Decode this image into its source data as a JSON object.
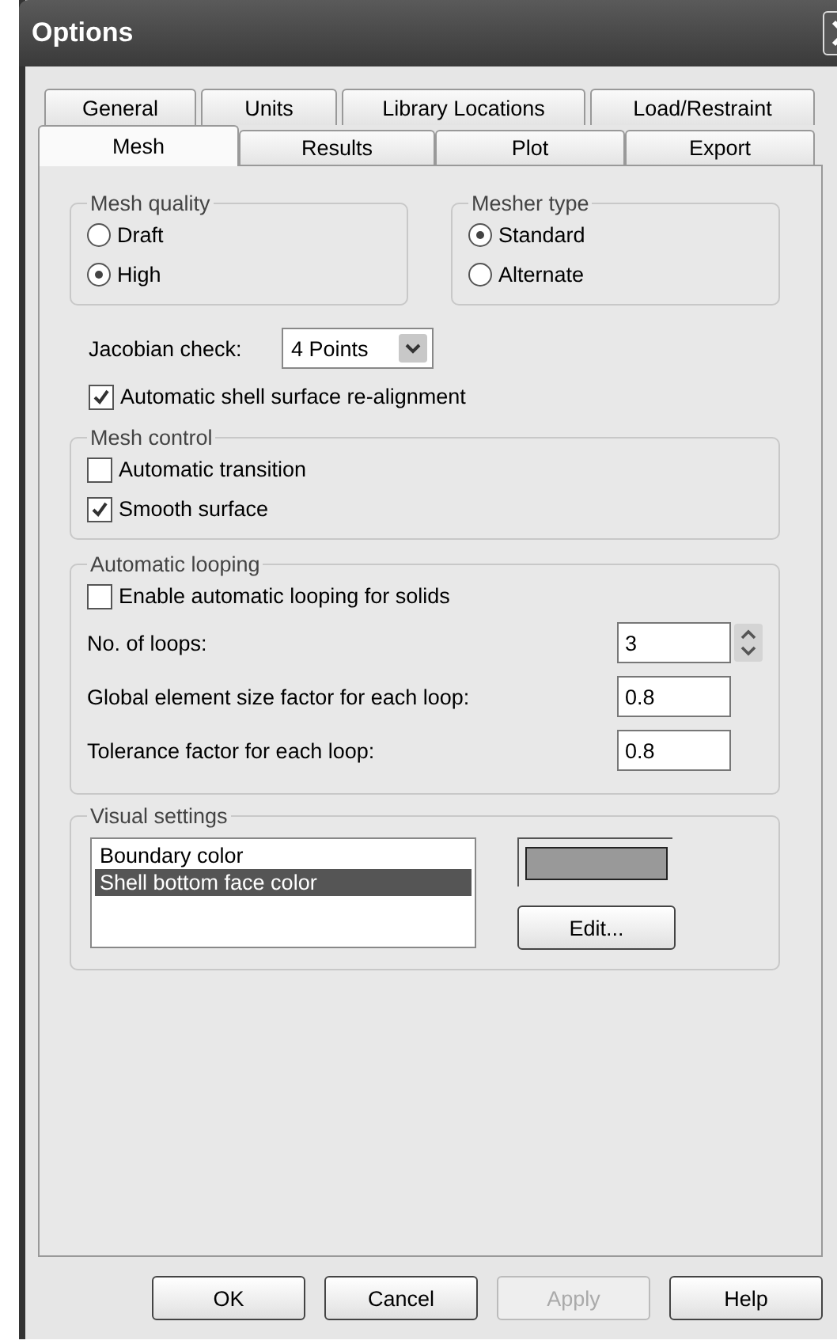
{
  "window": {
    "title": "Options"
  },
  "tab_rows": [
    {
      "tabs": [
        {
          "label": "General",
          "selected": false
        },
        {
          "label": "Units",
          "selected": false
        },
        {
          "label": "Library Locations",
          "selected": false
        },
        {
          "label": "Load/Restraint",
          "selected": false
        }
      ]
    },
    {
      "tabs": [
        {
          "label": "Mesh",
          "selected": true
        },
        {
          "label": "Results",
          "selected": false
        },
        {
          "label": "Plot",
          "selected": false
        },
        {
          "label": "Export",
          "selected": false
        }
      ]
    }
  ],
  "mesh_quality": {
    "label": "Mesh quality",
    "options": [
      {
        "label": "Draft",
        "selected": false
      },
      {
        "label": "High",
        "selected": true
      }
    ]
  },
  "mesher_type": {
    "label": "Mesher type",
    "options": [
      {
        "label": "Standard",
        "selected": true
      },
      {
        "label": "Alternate",
        "selected": false
      }
    ]
  },
  "jacobian_check": {
    "label": "Jacobian check:",
    "value": "4 Points"
  },
  "shell_realignment": {
    "label": "Automatic shell surface re-alignment",
    "checked": true
  },
  "mesh_control": {
    "label": "Mesh control",
    "options": [
      {
        "label": "Automatic transition",
        "checked": false
      },
      {
        "label": "Smooth surface",
        "checked": true
      }
    ]
  },
  "automatic_looping": {
    "label": "Automatic looping",
    "enable": {
      "label": "Enable automatic looping for solids",
      "checked": false
    },
    "fields": [
      {
        "label": "No. of loops:",
        "value": "3",
        "kind": "spinner"
      },
      {
        "label": "Global element size factor for each loop:",
        "value": "0.8",
        "kind": "text"
      },
      {
        "label": "Tolerance factor for each loop:",
        "value": "0.8",
        "kind": "text"
      }
    ]
  },
  "visual_settings": {
    "label": "Visual settings",
    "items": [
      {
        "label": "Boundary color",
        "selected": false
      },
      {
        "label": "Shell bottom face color",
        "selected": true
      }
    ],
    "edit_button": "Edit..."
  },
  "buttons": [
    {
      "label": "OK",
      "disabled": false
    },
    {
      "label": "Cancel",
      "disabled": false
    },
    {
      "label": "Apply",
      "disabled": true
    },
    {
      "label": "Help",
      "disabled": false
    }
  ]
}
